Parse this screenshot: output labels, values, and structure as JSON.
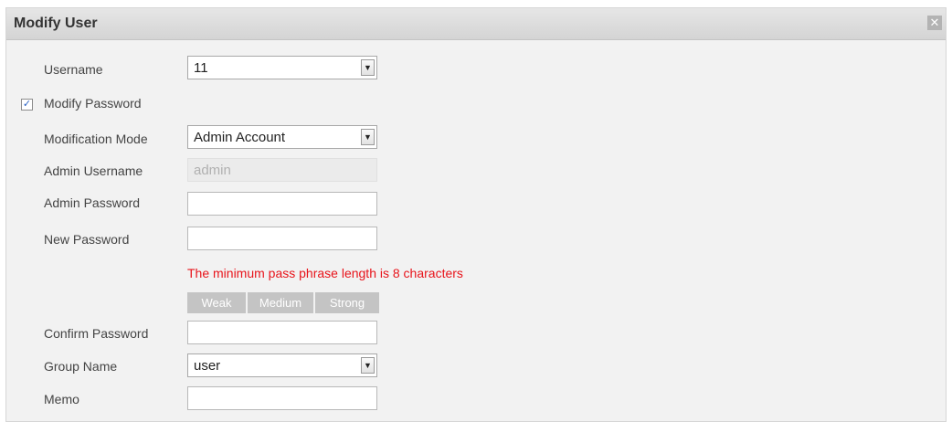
{
  "dialog": {
    "title": "Modify User",
    "close_glyph": "✕",
    "close_icon": "close-icon"
  },
  "form": {
    "username": {
      "label": "Username",
      "value": "11"
    },
    "modify_password": {
      "label": "Modify Password",
      "checked": true,
      "check_glyph": "✓"
    },
    "modification_mode": {
      "label": "Modification Mode",
      "value": "Admin Account"
    },
    "admin_username": {
      "label": "Admin Username",
      "value": "admin"
    },
    "admin_password": {
      "label": "Admin Password",
      "value": ""
    },
    "new_password": {
      "label": "New Password",
      "value": ""
    },
    "hint": "The minimum pass phrase length is 8 characters",
    "strength": [
      "Weak",
      "Medium",
      "Strong"
    ],
    "confirm_password": {
      "label": "Confirm Password",
      "value": ""
    },
    "group_name": {
      "label": "Group Name",
      "value": "user"
    },
    "memo": {
      "label": "Memo",
      "value": ""
    }
  },
  "icons": {
    "dropdown_arrow": "▼",
    "dropdown_icon": "chevron-down-icon"
  },
  "colors": {
    "hint_red": "#e8141b",
    "strength_gray": "#c4c4c4",
    "dialog_bg": "#f2f2f2"
  }
}
